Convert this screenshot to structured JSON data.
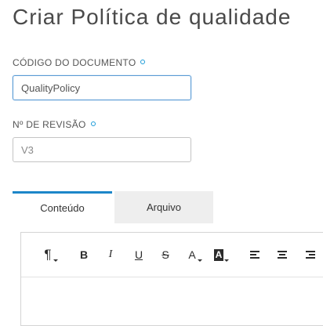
{
  "page": {
    "title": "Criar Política de qualidade"
  },
  "fields": {
    "document_code": {
      "label": "CÓDIGO DO DOCUMENTO",
      "value": "QualityPolicy",
      "required": true
    },
    "revision": {
      "label": "Nº DE REVISÃO",
      "placeholder": "V3",
      "required": true
    }
  },
  "tabs": [
    {
      "label": "Conteúdo",
      "active": true
    },
    {
      "label": "Arquivo",
      "active": false
    }
  ],
  "editor": {
    "toolbar": [
      {
        "icon": "paragraph-format-icon",
        "glyph": "¶"
      },
      {
        "icon": "bold-icon",
        "glyph": "B"
      },
      {
        "icon": "italic-icon",
        "glyph": "I"
      },
      {
        "icon": "underline-icon",
        "glyph": "U"
      },
      {
        "icon": "strikethrough-icon",
        "glyph": "S"
      },
      {
        "icon": "text-color-icon",
        "glyph": "A"
      },
      {
        "icon": "background-color-icon",
        "glyph": "A"
      },
      {
        "icon": "align-left-icon"
      },
      {
        "icon": "align-center-icon"
      },
      {
        "icon": "align-right-icon"
      }
    ]
  },
  "colors": {
    "accent": "#1c86c8",
    "required_dot": "#1c9bd8",
    "focus_border": "#5a9bd5"
  }
}
